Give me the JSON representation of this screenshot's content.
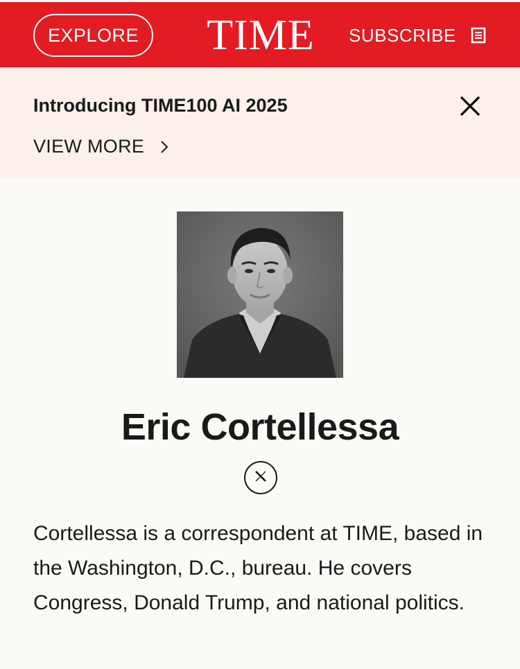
{
  "header": {
    "explore_label": "EXPLORE",
    "logo_text": "TIME",
    "subscribe_label": "SUBSCRIBE",
    "brand_color": "#e31b23",
    "subscribe_icon": "document-icon"
  },
  "banner": {
    "title": "Introducing TIME100 AI 2025",
    "view_more_label": "VIEW MORE",
    "close_icon": "close-icon",
    "background": "#fbf0ea"
  },
  "author": {
    "name": "Eric Cortellessa",
    "social_icon": "x-icon",
    "bio": "Cortellessa is a correspondent at TIME, based in the Washington, D.C., bureau. He covers Congress, Donald Trump, and national politics."
  }
}
